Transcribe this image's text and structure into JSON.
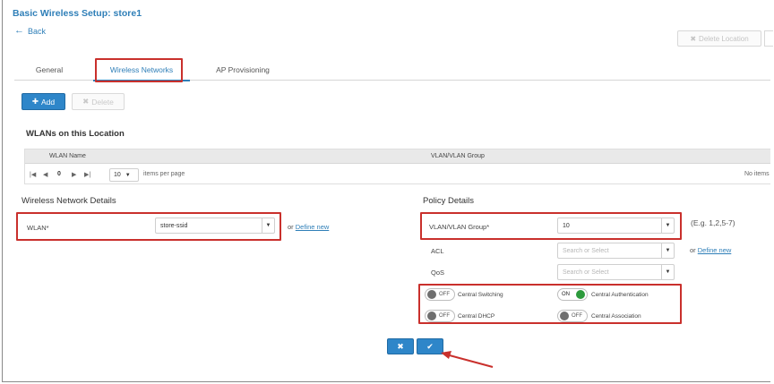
{
  "header": {
    "title": "Basic Wireless Setup: store1",
    "back_label": "Back",
    "delete_location_label": "Delete Location"
  },
  "tabs": [
    {
      "label": "General"
    },
    {
      "label": "Wireless Networks"
    },
    {
      "label": "AP Provisioning"
    }
  ],
  "toolbar": {
    "add_label": "Add",
    "delete_label": "Delete"
  },
  "wlans": {
    "title": "WLANs on this Location",
    "columns": [
      "WLAN Name",
      "VLAN/VLAN Group"
    ],
    "pager": {
      "page": "0",
      "per_page": "10",
      "per_page_suffix": "items per page",
      "no_items": "No items"
    }
  },
  "wireless_details": {
    "title": "Wireless Network Details",
    "wlan_label": "WLAN*",
    "wlan_value": "store-ssid",
    "or_text": "or",
    "define_new": "Define new"
  },
  "policy_details": {
    "title": "Policy Details",
    "vlan_label": "VLAN/VLAN Group*",
    "vlan_value": "10",
    "vlan_hint": "(E.g. 1,2,5-7)",
    "acl_label": "ACL",
    "acl_placeholder": "Search or Select",
    "qos_label": "QoS",
    "qos_placeholder": "Search or Select",
    "or_text": "or",
    "define_new": "Define new",
    "toggles": [
      {
        "state": "OFF",
        "label": "Central Switching"
      },
      {
        "state": "ON",
        "label": "Central Authentication"
      },
      {
        "state": "OFF",
        "label": "Central DHCP"
      },
      {
        "state": "OFF",
        "label": "Central Association"
      }
    ]
  },
  "footer": {
    "cancel_icon": "close-icon",
    "save_icon": "check-icon"
  },
  "colors": {
    "accent": "#2e86c9",
    "highlight": "#c9302c",
    "toggle_on": "#2c9a3c"
  }
}
